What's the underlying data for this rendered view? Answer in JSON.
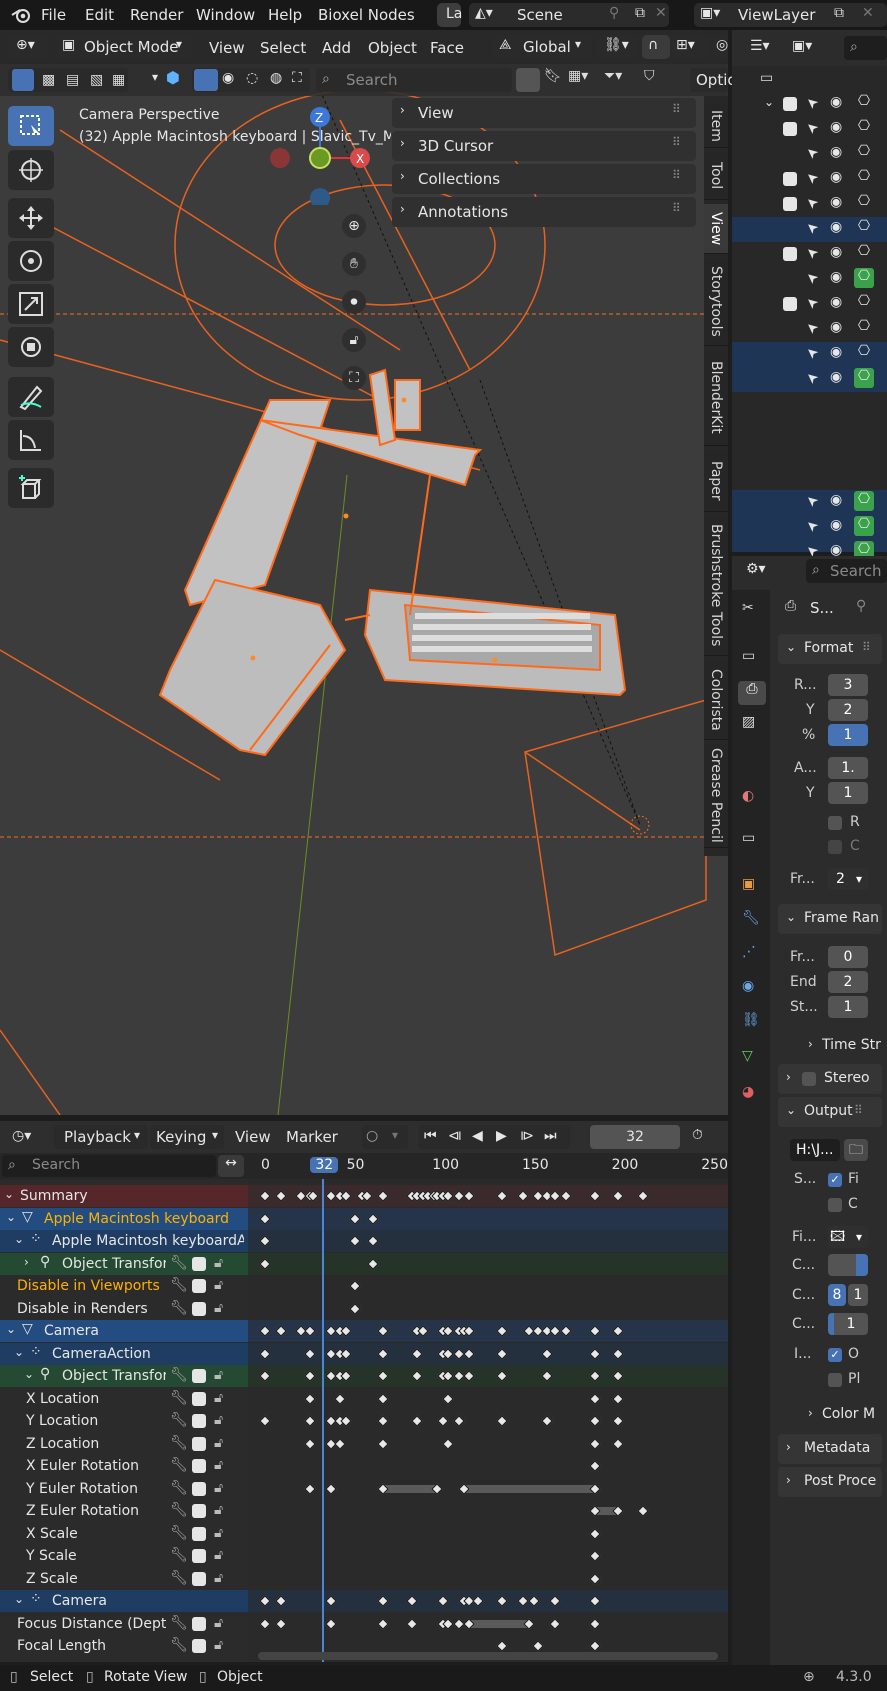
{
  "topbar": {
    "menus": [
      "File",
      "Edit",
      "Render",
      "Window",
      "Help",
      "Bioxel Nodes"
    ],
    "workspace_tab": "La",
    "scene": "Scene",
    "view_layer": "ViewLayer"
  },
  "viewport_header": {
    "mode": "Object Mode",
    "menus": [
      "View",
      "Select",
      "Add",
      "Object",
      "Face"
    ],
    "transform_orientation": "Global",
    "search_placeholder": "Search",
    "options_label": "Optio"
  },
  "viewport": {
    "camera_label": "Camera Perspective",
    "object_label": "(32) Apple Macintosh keyboard | Slavic_Tv_Mes",
    "gizmo_axes": [
      "Z",
      "X"
    ]
  },
  "npanel": {
    "items": [
      "View",
      "3D Cursor",
      "Collections",
      "Annotations"
    ]
  },
  "side_tabs": [
    "Item",
    "Tool",
    "View",
    "Storytools",
    "BlenderKit",
    "Paper",
    "Brushstroke Tools",
    "Colorista",
    "Grease Pencil"
  ],
  "outliner": {
    "search_placeholder": "Search"
  },
  "properties": {
    "header_label": "S...",
    "format_title": "Format",
    "fields": {
      "res_x_label": "R...",
      "res_x": "3",
      "res_y_label": "Y",
      "res_y": "2",
      "pct_label": "%",
      "pct": "1",
      "aspect_label": "A...",
      "aspect_x": "1.",
      "aspect_y_label": "Y",
      "aspect_y": "1",
      "render_region": "R",
      "crop": "C",
      "fps_label": "Fr...",
      "fps": "2"
    },
    "frame_range_title": "Frame Ran",
    "frame_fields": {
      "start_label": "Fr...",
      "start": "0",
      "end_label": "End",
      "end": "2",
      "step_label": "St...",
      "step": "1"
    },
    "time_stretch": "Time Str",
    "stereo": "Stereo",
    "output_title": "Output",
    "output_path": "H:\\J...",
    "output_rows": {
      "s_label": "S...",
      "s_val": "Fi",
      "c_val": "C",
      "fi_label": "Fi...",
      "c1_label": "C...",
      "c2_label": "C...",
      "c2_a": "8",
      "c2_b": "1",
      "c3_label": "C...",
      "c3_val": "1",
      "i_label": "I...",
      "i_val": "O",
      "pl_val": "Pl"
    },
    "color_m": "Color M",
    "metadata": "Metadata",
    "post_proc": "Post Proce"
  },
  "dopesheet": {
    "menus": [
      "Playback",
      "Keying",
      "View",
      "Marker"
    ],
    "current_frame": "32",
    "search_placeholder": "Search",
    "ruler": [
      "0",
      "32",
      "50",
      "100",
      "150",
      "200",
      "250"
    ],
    "channels": [
      {
        "label": "Summary",
        "kind": "summary",
        "indent": 0
      },
      {
        "label": "Apple Macintosh keyboard",
        "kind": "object",
        "indent": 1
      },
      {
        "label": "Apple Macintosh keyboardA",
        "kind": "action",
        "indent": 2
      },
      {
        "label": "Object Transform",
        "kind": "group",
        "indent": 3
      },
      {
        "label": "Disable in Viewports",
        "kind": "fcurve-orange",
        "indent": 2
      },
      {
        "label": "Disable in Renders",
        "kind": "fcurve",
        "indent": 2
      },
      {
        "label": "Camera",
        "kind": "object",
        "indent": 1
      },
      {
        "label": "CameraAction",
        "kind": "action",
        "indent": 2
      },
      {
        "label": "Object Transform",
        "kind": "group",
        "indent": 3
      },
      {
        "label": "X Location",
        "kind": "fcurve",
        "indent": 3
      },
      {
        "label": "Y Location",
        "kind": "fcurve",
        "indent": 3
      },
      {
        "label": "Z Location",
        "kind": "fcurve",
        "indent": 3
      },
      {
        "label": "X Euler Rotation",
        "kind": "fcurve",
        "indent": 3
      },
      {
        "label": "Y Euler Rotation",
        "kind": "fcurve",
        "indent": 3
      },
      {
        "label": "Z Euler Rotation",
        "kind": "fcurve",
        "indent": 3
      },
      {
        "label": "X Scale",
        "kind": "fcurve",
        "indent": 3
      },
      {
        "label": "Y Scale",
        "kind": "fcurve",
        "indent": 3
      },
      {
        "label": "Z Scale",
        "kind": "fcurve",
        "indent": 3
      },
      {
        "label": "Camera",
        "kind": "action",
        "indent": 2
      },
      {
        "label": "Focus Distance (Depth",
        "kind": "fcurve",
        "indent": 2
      },
      {
        "label": "Focal Length",
        "kind": "fcurve",
        "indent": 2
      }
    ],
    "keyframes": [
      [
        0,
        9,
        20,
        25,
        27,
        37,
        42,
        45,
        54,
        57,
        66,
        82,
        85,
        88,
        91,
        94,
        96,
        99,
        102,
        108,
        114,
        132,
        144,
        152,
        157,
        162,
        168,
        184,
        197,
        211
      ],
      [
        0,
        50,
        60
      ],
      [
        0,
        50,
        60
      ],
      [
        0,
        60
      ],
      [
        50
      ],
      [
        50
      ],
      [
        0,
        9,
        20,
        25,
        37,
        42,
        45,
        66,
        85,
        88,
        99,
        102,
        108,
        111,
        114,
        132,
        147,
        152,
        157,
        162,
        168,
        184,
        197
      ],
      [
        0,
        25,
        37,
        42,
        45,
        66,
        85,
        99,
        102,
        108,
        114,
        132,
        157,
        184,
        197
      ],
      [
        0,
        25,
        37,
        42,
        45,
        66,
        85,
        99,
        102,
        108,
        114,
        132,
        157,
        184,
        197
      ],
      [
        25,
        42,
        66,
        102,
        184,
        197
      ],
      [
        0,
        25,
        37,
        42,
        45,
        66,
        85,
        99,
        108,
        132,
        157,
        184,
        197
      ],
      [
        25,
        37,
        42,
        66,
        102,
        184,
        197
      ],
      [
        184
      ],
      [
        25,
        37,
        66,
        96,
        111,
        184
      ],
      [
        184,
        197,
        211
      ],
      [
        184
      ],
      [
        184
      ],
      [
        184
      ],
      [
        0,
        9,
        37,
        66,
        82,
        99,
        111,
        114,
        119,
        132,
        144,
        150,
        162,
        184
      ],
      [
        0,
        9,
        37,
        66,
        82,
        99,
        102,
        108,
        114,
        147,
        162,
        184
      ],
      [
        132,
        152,
        184
      ]
    ],
    "holds": [
      {
        "row": 13,
        "from": 66,
        "to": 96
      },
      {
        "row": 13,
        "from": 111,
        "to": 184
      },
      {
        "row": 14,
        "from": 184,
        "to": 197
      },
      {
        "row": 19,
        "from": 114,
        "to": 147
      }
    ]
  },
  "statusbar": {
    "select": "Select",
    "rotate_view": "Rotate View",
    "object": "Object",
    "version": "4.3.0"
  }
}
